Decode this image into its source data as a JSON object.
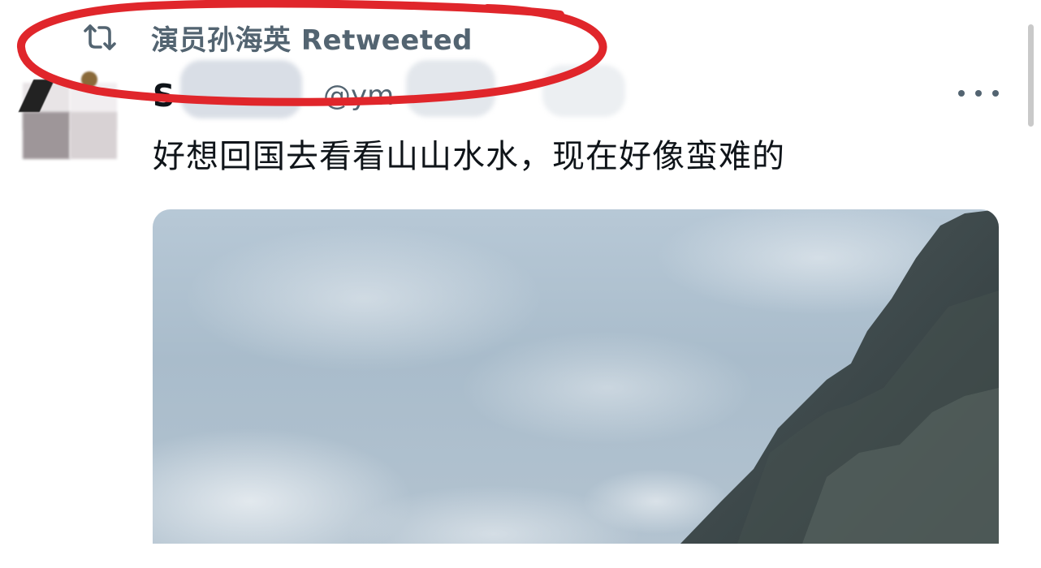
{
  "retweet": {
    "icon": "retweet-icon",
    "label": "演员孙海英 Retweeted"
  },
  "tweet": {
    "display_name": "S",
    "handle": "@ym",
    "text": "好想回国去看看山山水水，现在好像蛮难的",
    "more_icon": "more-horizontal-icon",
    "photo": "mountain-cloud-photo"
  },
  "annotation": {
    "color": "#e0262b",
    "shape": "hand-drawn-ellipse"
  },
  "colors": {
    "primary_text": "#0f1419",
    "secondary_text": "#536471"
  }
}
